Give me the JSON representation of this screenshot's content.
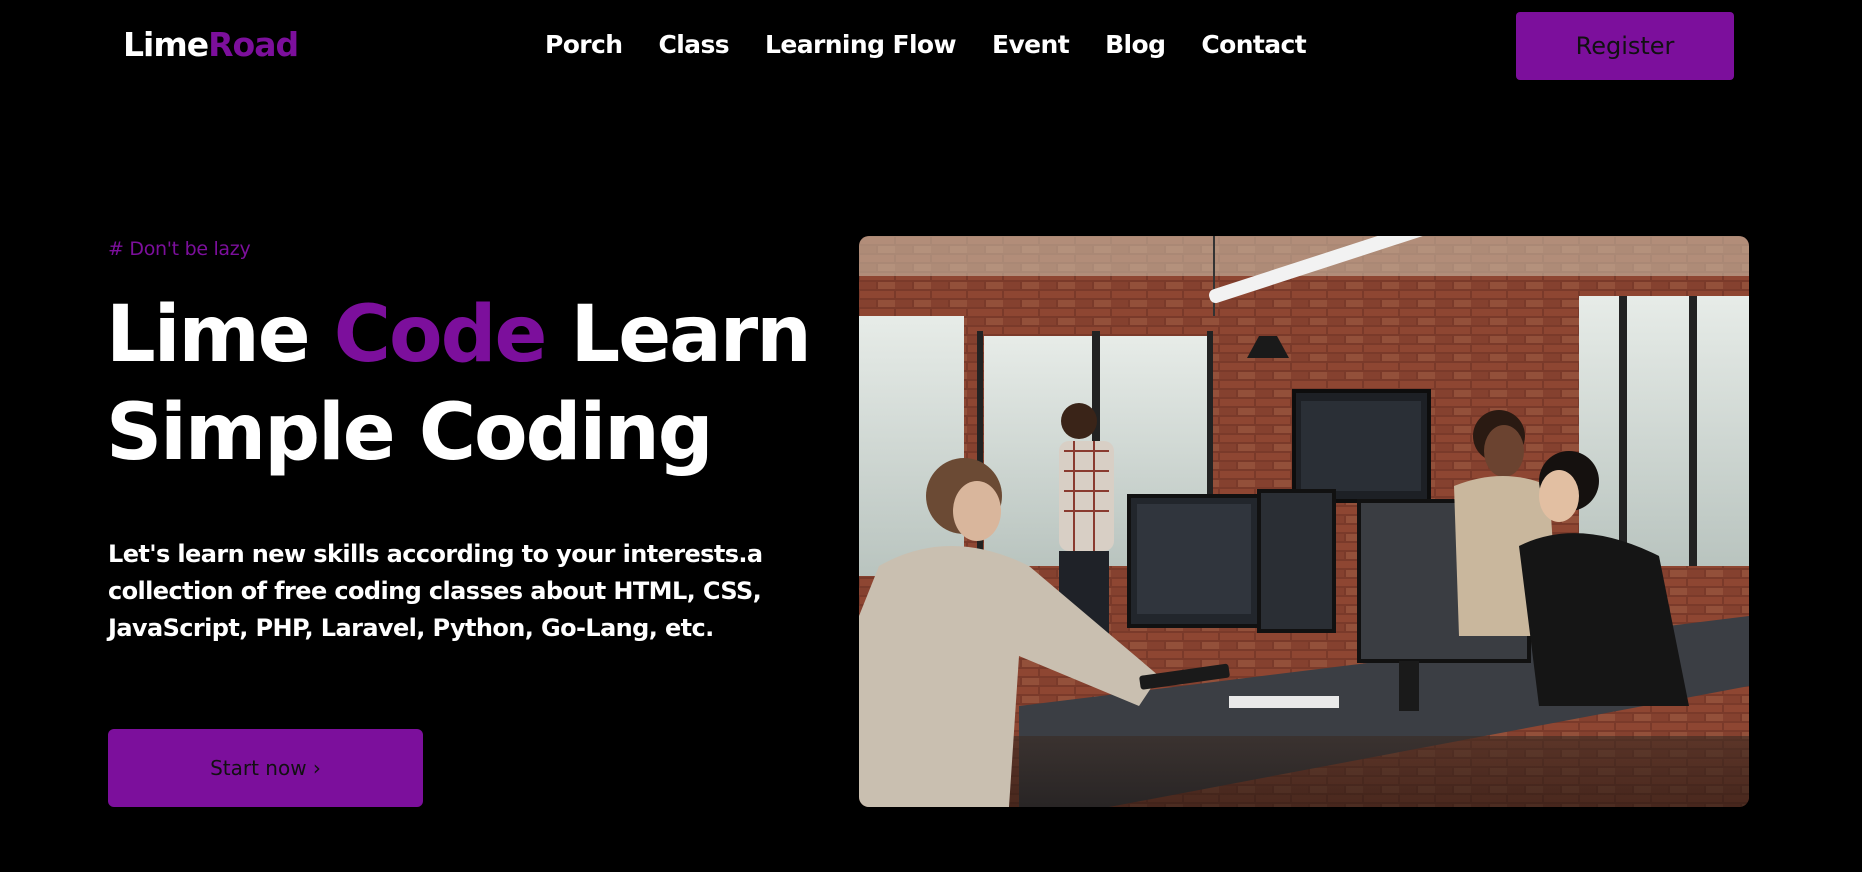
{
  "brand": {
    "part1": "Lime",
    "part2": "Road"
  },
  "nav": {
    "items": [
      {
        "label": "Porch"
      },
      {
        "label": "Class"
      },
      {
        "label": "Learning Flow"
      },
      {
        "label": "Event"
      },
      {
        "label": "Blog"
      },
      {
        "label": "Contact"
      }
    ]
  },
  "header": {
    "register_label": "Register"
  },
  "hero": {
    "tagline": "# Don't be lazy",
    "headline_1": "Lime ",
    "headline_accent": "Code",
    "headline_2": " Learn",
    "headline_line2": "Simple Coding",
    "description": "Let's learn new skills according to your interests.a collection of free coding classes about HTML, CSS, JavaScript, PHP, Laravel, Python, Go-Lang, etc.",
    "cta_label": "Start now ›"
  },
  "colors": {
    "accent": "#7c0f9c",
    "background": "#000000",
    "text": "#ffffff"
  }
}
